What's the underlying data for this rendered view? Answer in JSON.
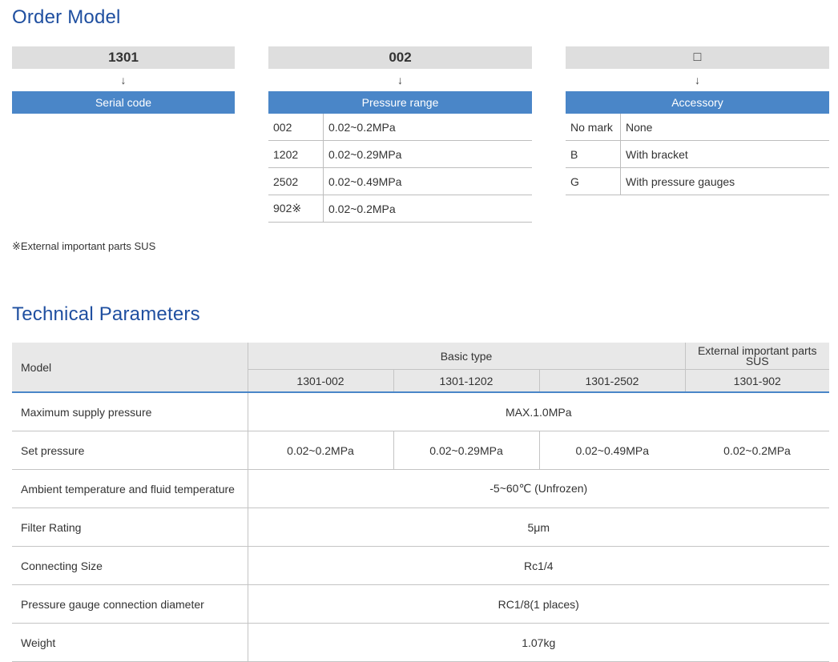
{
  "order_model": {
    "title": "Order Model",
    "arrow": "↓",
    "serial": {
      "code": "1301",
      "label": "Serial code"
    },
    "pressure": {
      "code": "002",
      "label": "Pressure range",
      "rows": [
        {
          "k": "002",
          "v": "0.02~0.2MPa"
        },
        {
          "k": "1202",
          "v": "0.02~0.29MPa"
        },
        {
          "k": "2502",
          "v": "0.02~0.49MPa"
        },
        {
          "k": "902※",
          "v": "0.02~0.2MPa"
        }
      ]
    },
    "accessory": {
      "code": "□",
      "label": "Accessory",
      "rows": [
        {
          "k": "No mark",
          "v": "None"
        },
        {
          "k": "B",
          "v": "With bracket"
        },
        {
          "k": "G",
          "v": "With pressure gauges"
        }
      ]
    },
    "footnote": "※External important parts SUS"
  },
  "technical": {
    "title": "Technical Parameters",
    "model_header": "Model",
    "basic_type": "Basic type",
    "external_header": "External important parts SUS",
    "models": [
      "1301-002",
      "1301-1202",
      "1301-2502",
      "1301-902"
    ],
    "rows": [
      {
        "label": "Maximum supply pressure",
        "value": "MAX.1.0MPa"
      },
      {
        "label": "Set pressure",
        "values": [
          "0.02~0.2MPa",
          "0.02~0.29MPa",
          "0.02~0.49MPa",
          "0.02~0.2MPa"
        ]
      },
      {
        "label": "Ambient temperature and fluid temperature",
        "value": "-5~60℃ (Unfrozen)"
      },
      {
        "label": "Filter Rating",
        "value": "5μm"
      },
      {
        "label": "Connecting Size",
        "value": "Rc1/4"
      },
      {
        "label": "Pressure gauge connection diameter",
        "value": "RC1/8(1 places)"
      },
      {
        "label": "Weight",
        "value": "1.07kg"
      }
    ]
  },
  "colors": {
    "title": "#1f4fa0",
    "header_bar": "#4a86c8",
    "code_box": "#dedede",
    "table_header": "#e8e8e8"
  }
}
